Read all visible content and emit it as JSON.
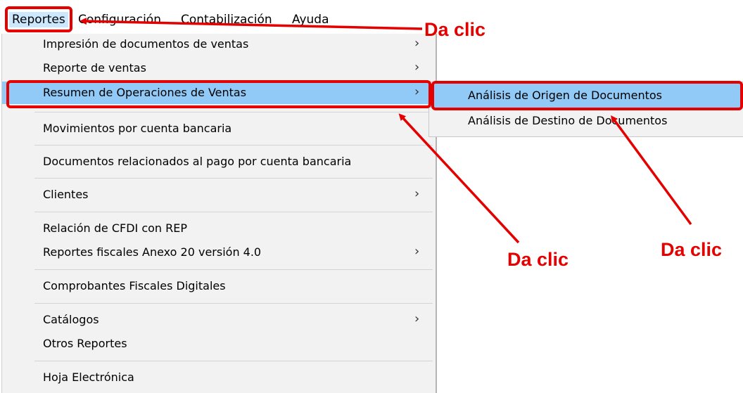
{
  "menubar": {
    "items": [
      {
        "label": "Reportes"
      },
      {
        "label": "Configuración"
      },
      {
        "label": "Contabilización"
      },
      {
        "label": "Ayuda"
      }
    ]
  },
  "reportes_menu": {
    "items": [
      {
        "label": "Impresión de documentos de ventas",
        "submenu": true
      },
      {
        "label": "Reporte de ventas",
        "submenu": true
      },
      {
        "label": "Resumen de Operaciones de Ventas",
        "submenu": true,
        "highlighted": true
      },
      {
        "label": "Movimientos por cuenta bancaria",
        "submenu": false
      },
      {
        "label": "Documentos relacionados al pago por cuenta bancaria",
        "submenu": false
      },
      {
        "label": "Clientes",
        "submenu": true
      },
      {
        "label": "Relación de CFDI con REP",
        "submenu": false
      },
      {
        "label": "Reportes fiscales Anexo 20 versión 4.0",
        "submenu": true
      },
      {
        "label": "Comprobantes Fiscales Digitales",
        "submenu": false
      },
      {
        "label": "Catálogos",
        "submenu": true
      },
      {
        "label": "Otros Reportes",
        "submenu": false
      },
      {
        "label": "Hoja Electrónica",
        "submenu": false
      }
    ]
  },
  "submenu": {
    "items": [
      {
        "label": "Análisis de Origen de Documentos",
        "highlighted": true
      },
      {
        "label": "Análisis de Destino de Documentos"
      }
    ]
  },
  "annotations": {
    "callouts": [
      "Da clic",
      "Da clic",
      "Da clic"
    ],
    "color": "#e50000"
  },
  "icons": {
    "submenu_arrow": "chevron-right-icon",
    "submenu_arrow_glyph": "›"
  },
  "colors": {
    "highlight": "#91c9f7",
    "menu_bg": "#f2f2f2",
    "menubar_active": "#cce8ff"
  }
}
